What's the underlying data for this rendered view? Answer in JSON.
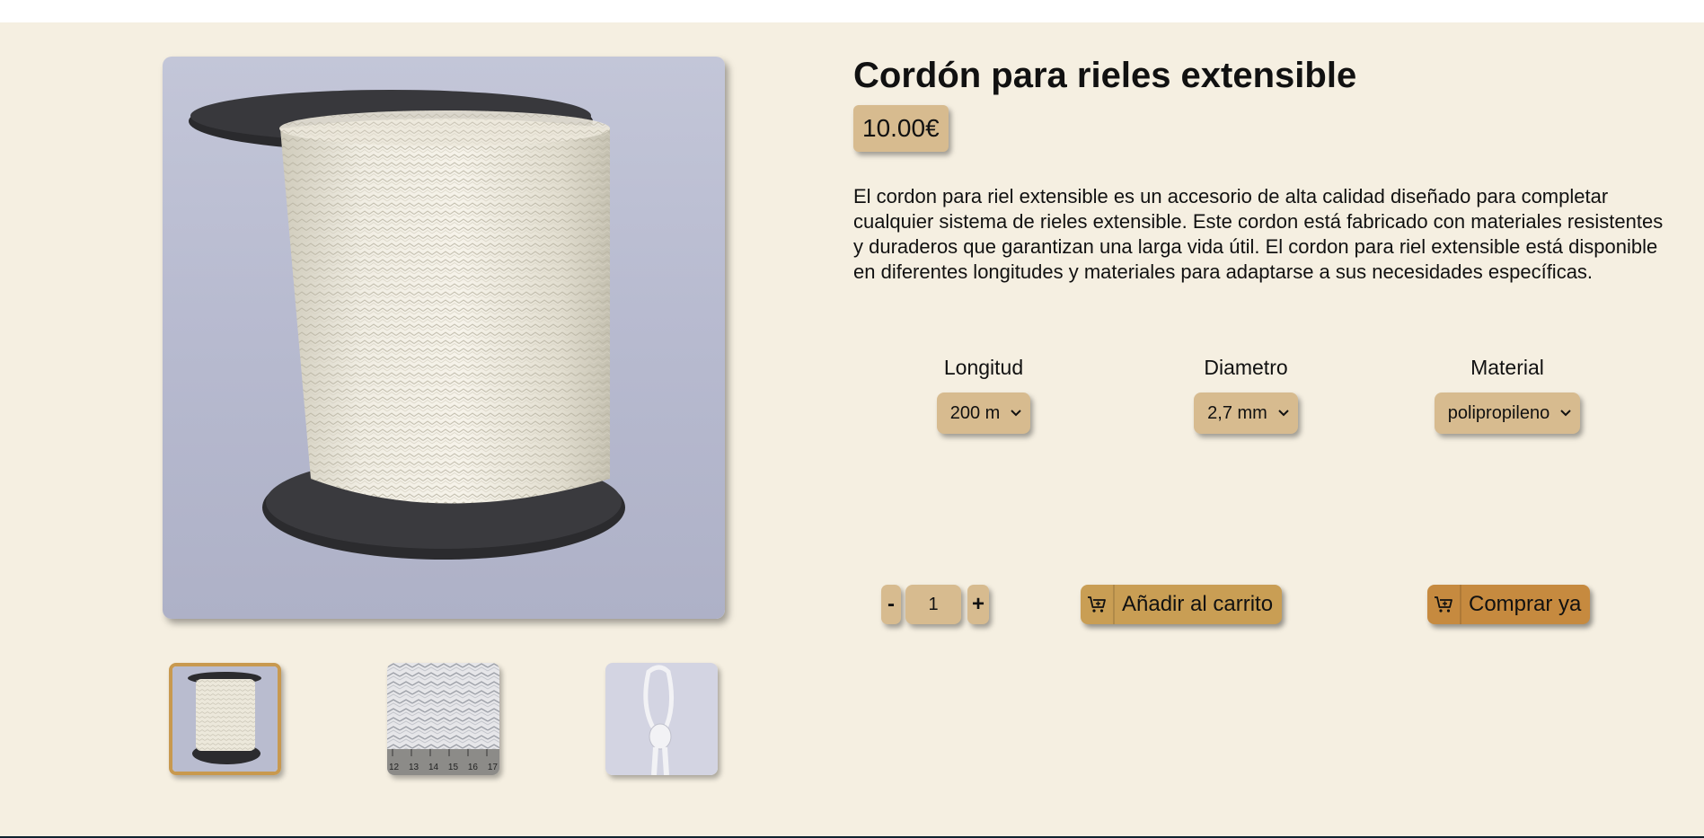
{
  "product": {
    "title": "Cordón para rieles extensible",
    "price": "10.00€",
    "description": "El cordon para riel extensible es un accesorio de alta calidad diseñado para completar cualquier sistema de rieles extensible. Este cordon está fabricado con materiales resistentes y duraderos que garantizan una larga vida útil. El cordon para riel extensible está disponible en diferentes longitudes y materiales para adaptarse a sus necesidades específicas."
  },
  "gallery": {
    "main_image": "white braided cord on black spool",
    "thumbnails": [
      {
        "image": "spool of cord",
        "active": true
      },
      {
        "image": "cord close-up with ruler",
        "active": false
      },
      {
        "image": "knotted cord loop",
        "active": false
      }
    ],
    "ruler_marks": [
      "12",
      "13",
      "14",
      "15",
      "16",
      "17"
    ]
  },
  "options": {
    "longitud": {
      "label": "Longitud",
      "value": "200 m"
    },
    "diametro": {
      "label": "Diametro",
      "value": "2,7 mm"
    },
    "material": {
      "label": "Material",
      "value": "polipropileno"
    }
  },
  "quantity": {
    "minus": "-",
    "value": "1",
    "plus": "+"
  },
  "actions": {
    "add_to_cart": "Añadir al carrito",
    "buy_now": "Comprar ya",
    "cart_icon": "cart-plus-icon"
  },
  "colors": {
    "background": "#f5efe1",
    "tan": "#d7bb8f",
    "cart_button": "#c99e54",
    "buy_button": "#c68a3f"
  }
}
